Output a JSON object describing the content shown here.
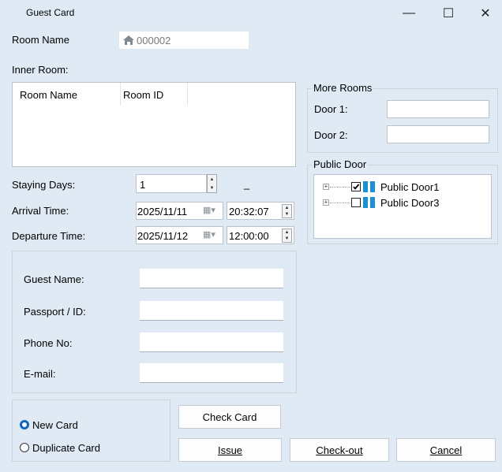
{
  "window": {
    "title": "Guest Card",
    "controls": {
      "minimize": "—",
      "maximize": "☐",
      "close": "✕"
    }
  },
  "room_name": {
    "label": "Room Name",
    "value": "000002",
    "icon": "home-icon"
  },
  "inner_room": {
    "label": "Inner Room:",
    "columns": [
      "Room Name",
      "Room ID"
    ],
    "rows": []
  },
  "more_rooms": {
    "title": "More Rooms",
    "door1_label": "Door 1:",
    "door1_value": "",
    "door2_label": "Door 2:",
    "door2_value": ""
  },
  "public_door": {
    "title": "Public Door",
    "items": [
      {
        "label": "Public Door1",
        "checked": true
      },
      {
        "label": "Public Door3",
        "checked": false
      }
    ]
  },
  "staying_days": {
    "label": "Staying Days:",
    "value": "1",
    "suffix": "_"
  },
  "arrival": {
    "label": "Arrival Time:",
    "date": "2025/11/11",
    "time": "20:32:07"
  },
  "departure": {
    "label": "Departure Time:",
    "date": "2025/11/12",
    "time": "12:00:00"
  },
  "guest": {
    "name_label": "Guest Name:",
    "name_value": "",
    "passport_label": "Passport / ID:",
    "passport_value": "",
    "phone_label": "Phone No:",
    "phone_value": "",
    "email_label": "E-mail:",
    "email_value": ""
  },
  "card_type": {
    "options": [
      "New Card",
      "Duplicate Card"
    ],
    "selected": "New Card"
  },
  "buttons": {
    "check_card": "Check Card",
    "issue": "Issue",
    "checkout": "Check-out",
    "cancel": "Cancel"
  },
  "colors": {
    "accent": "#0f66c0",
    "background": "#dfeaf5",
    "door_icon": "#1c8fd8"
  }
}
